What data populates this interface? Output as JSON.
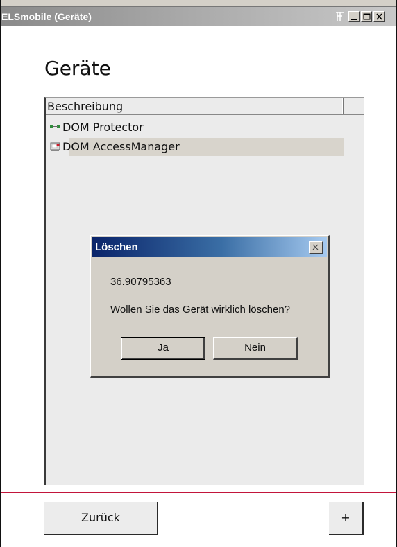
{
  "window": {
    "title": "ELSmobile (Geräte)"
  },
  "page": {
    "title": "Geräte"
  },
  "list": {
    "column_header": "Beschreibung",
    "rows": [
      {
        "label": "DOM Protector",
        "icon": "device-link-icon",
        "selected": false
      },
      {
        "label": "DOM AccessManager",
        "icon": "device-red-icon",
        "selected": true
      }
    ]
  },
  "dialog": {
    "title": "Löschen",
    "value": "36.90795363",
    "message": "Wollen Sie das Gerät wirklich löschen?",
    "yes_label": "Ja",
    "no_label": "Nein"
  },
  "footer": {
    "back_label": "Zurück",
    "add_label": "+"
  },
  "colors": {
    "accent_line": "#c2153b",
    "dialog_title_start": "#0a246a",
    "dialog_title_end": "#a6caf0"
  }
}
